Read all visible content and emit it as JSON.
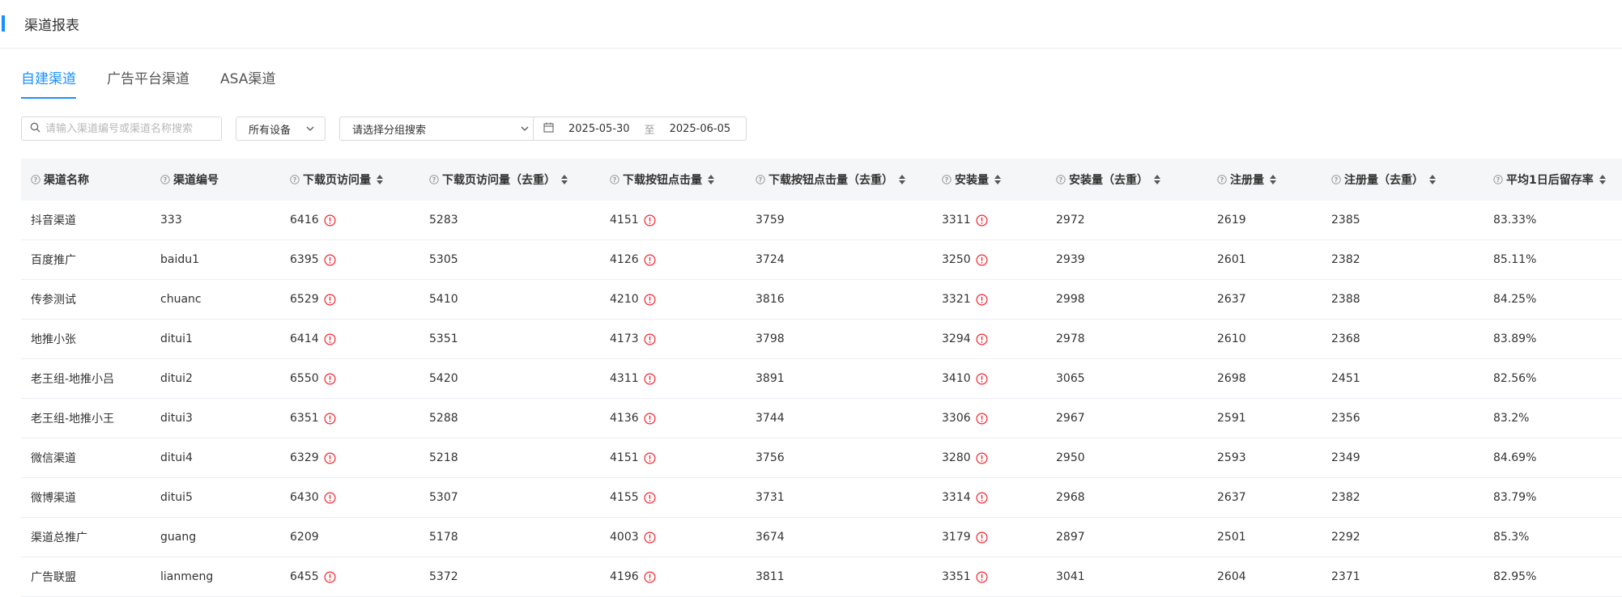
{
  "header": {
    "title": "渠道报表"
  },
  "tabs": [
    {
      "label": "自建渠道",
      "active": true
    },
    {
      "label": "广告平台渠道",
      "active": false
    },
    {
      "label": "ASA渠道",
      "active": false
    }
  ],
  "filters": {
    "search_placeholder": "请输入渠道编号或渠道名称搜索",
    "device_value": "所有设备",
    "group_value": "请选择分组搜索",
    "date_start": "2025-05-30",
    "date_separator": "至",
    "date_end": "2025-06-05"
  },
  "colors": {
    "accent": "#1890ff",
    "warning": "#f5222d",
    "header_bg": "#f5f6f8"
  },
  "icons": {
    "search": "search-icon",
    "chevron": "chevron-down-icon",
    "calendar": "calendar-icon",
    "help": "question-circle-icon",
    "sort": "sort-icon",
    "warning": "exclamation-circle-icon"
  },
  "table": {
    "columns": [
      {
        "label": "渠道名称",
        "sortable": false
      },
      {
        "label": "渠道编号",
        "sortable": false
      },
      {
        "label": "下载页访问量",
        "sortable": true
      },
      {
        "label": "下载页访问量（去重）",
        "sortable": true
      },
      {
        "label": "下载按钮点击量",
        "sortable": true
      },
      {
        "label": "下载按钮点击量（去重）",
        "sortable": true
      },
      {
        "label": "安装量",
        "sortable": true
      },
      {
        "label": "安装量（去重）",
        "sortable": true
      },
      {
        "label": "注册量",
        "sortable": true
      },
      {
        "label": "注册量（去重）",
        "sortable": true
      },
      {
        "label": "平均1日后留存率",
        "sortable": true
      }
    ],
    "rows": [
      {
        "name": "抖音渠道",
        "code": "333",
        "visits": "6416",
        "visits_warn": true,
        "visits_dedup": "5283",
        "clicks": "4151",
        "clicks_warn": true,
        "clicks_dedup": "3759",
        "installs": "3311",
        "installs_warn": true,
        "installs_dedup": "2972",
        "registers": "2619",
        "registers_dedup": "2385",
        "retention": "83.33%"
      },
      {
        "name": "百度推广",
        "code": "baidu1",
        "visits": "6395",
        "visits_warn": true,
        "visits_dedup": "5305",
        "clicks": "4126",
        "clicks_warn": true,
        "clicks_dedup": "3724",
        "installs": "3250",
        "installs_warn": true,
        "installs_dedup": "2939",
        "registers": "2601",
        "registers_dedup": "2382",
        "retention": "85.11%"
      },
      {
        "name": "传参测试",
        "code": "chuanc",
        "visits": "6529",
        "visits_warn": true,
        "visits_dedup": "5410",
        "clicks": "4210",
        "clicks_warn": true,
        "clicks_dedup": "3816",
        "installs": "3321",
        "installs_warn": true,
        "installs_dedup": "2998",
        "registers": "2637",
        "registers_dedup": "2388",
        "retention": "84.25%"
      },
      {
        "name": "地推小张",
        "code": "ditui1",
        "visits": "6414",
        "visits_warn": true,
        "visits_dedup": "5351",
        "clicks": "4173",
        "clicks_warn": true,
        "clicks_dedup": "3798",
        "installs": "3294",
        "installs_warn": true,
        "installs_dedup": "2978",
        "registers": "2610",
        "registers_dedup": "2368",
        "retention": "83.89%"
      },
      {
        "name": "老王组-地推小吕",
        "code": "ditui2",
        "visits": "6550",
        "visits_warn": true,
        "visits_dedup": "5420",
        "clicks": "4311",
        "clicks_warn": true,
        "clicks_dedup": "3891",
        "installs": "3410",
        "installs_warn": true,
        "installs_dedup": "3065",
        "registers": "2698",
        "registers_dedup": "2451",
        "retention": "82.56%"
      },
      {
        "name": "老王组-地推小王",
        "code": "ditui3",
        "visits": "6351",
        "visits_warn": true,
        "visits_dedup": "5288",
        "clicks": "4136",
        "clicks_warn": true,
        "clicks_dedup": "3744",
        "installs": "3306",
        "installs_warn": true,
        "installs_dedup": "2967",
        "registers": "2591",
        "registers_dedup": "2356",
        "retention": "83.2%"
      },
      {
        "name": "微信渠道",
        "code": "ditui4",
        "visits": "6329",
        "visits_warn": true,
        "visits_dedup": "5218",
        "clicks": "4151",
        "clicks_warn": true,
        "clicks_dedup": "3756",
        "installs": "3280",
        "installs_warn": true,
        "installs_dedup": "2950",
        "registers": "2593",
        "registers_dedup": "2349",
        "retention": "84.69%"
      },
      {
        "name": "微博渠道",
        "code": "ditui5",
        "visits": "6430",
        "visits_warn": true,
        "visits_dedup": "5307",
        "clicks": "4155",
        "clicks_warn": true,
        "clicks_dedup": "3731",
        "installs": "3314",
        "installs_warn": true,
        "installs_dedup": "2968",
        "registers": "2637",
        "registers_dedup": "2382",
        "retention": "83.79%"
      },
      {
        "name": "渠道总推广",
        "code": "guang",
        "visits": "6209",
        "visits_warn": false,
        "visits_dedup": "5178",
        "clicks": "4003",
        "clicks_warn": true,
        "clicks_dedup": "3674",
        "installs": "3179",
        "installs_warn": true,
        "installs_dedup": "2897",
        "registers": "2501",
        "registers_dedup": "2292",
        "retention": "85.3%"
      },
      {
        "name": "广告联盟",
        "code": "lianmeng",
        "visits": "6455",
        "visits_warn": true,
        "visits_dedup": "5372",
        "clicks": "4196",
        "clicks_warn": true,
        "clicks_dedup": "3811",
        "installs": "3351",
        "installs_warn": true,
        "installs_dedup": "3041",
        "registers": "2604",
        "registers_dedup": "2371",
        "retention": "82.95%"
      }
    ]
  }
}
